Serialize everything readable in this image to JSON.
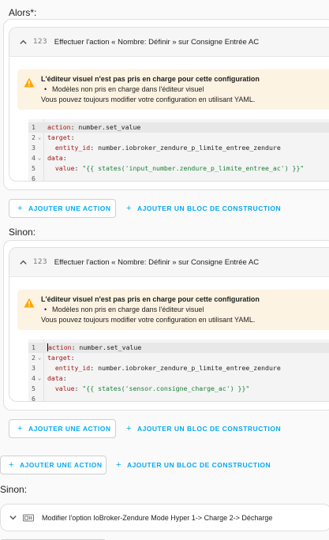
{
  "labels": {
    "alors": "Alors*:",
    "sinon1": "Sinon:",
    "sinon2": "Sinon:"
  },
  "actions": [
    {
      "icon_text": "123",
      "title": "Effectuer l'action « Nombre: Définir » sur Consigne Entrée AC",
      "warning": {
        "title": "L'éditeur visuel n'est pas pris en charge pour cette configuration",
        "bullet": "Modèles non pris en charge dans l'éditeur visuel",
        "text": "Vous pouvez toujours modifier votre configuration en utilisant YAML."
      },
      "code": {
        "line_numbers": [
          "1",
          "2",
          "3",
          "4",
          "5",
          "6"
        ],
        "k1": "action",
        "v1": ": number.set_value",
        "k2": "target",
        "v2": ":",
        "k3": "entity_id",
        "v3": ": number.iobroker_zendure_p_limite_entree_zendure",
        "k4": "data",
        "v4": ":",
        "k5": "value",
        "v5a": ": ",
        "v5b": "\"{{ states('input_number.zendure_p_limite_entree_ac') }}\""
      }
    },
    {
      "icon_text": "123",
      "title": "Effectuer l'action « Nombre: Définir » sur Consigne Entrée AC",
      "warning": {
        "title": "L'éditeur visuel n'est pas pris en charge pour cette configuration",
        "bullet": "Modèles non pris en charge dans l'éditeur visuel",
        "text": "Vous pouvez toujours modifier votre configuration en utilisant YAML."
      },
      "code": {
        "line_numbers": [
          "1",
          "2",
          "3",
          "4",
          "5",
          "6"
        ],
        "k1": "action",
        "v1": ": number.set_value",
        "k2": "target",
        "v2": ":",
        "k3": "entity_id",
        "v3": ": number.iobroker_zendure_p_limite_entree_zendure",
        "k4": "data",
        "v4": ":",
        "k5": "value",
        "v5a": ": ",
        "v5b": "\"{{ states('sensor.consigne_charge_ac') }}\""
      }
    }
  ],
  "buttons": {
    "add_action": "AJOUTER UNE ACTION",
    "add_block": "AJOUTER UN BLOC DE CONSTRUCTION",
    "plus": "+"
  },
  "bottom": {
    "title": "Modifier l'option IoBroker-Zendure Mode Hyper 1-> Charge 2-> Décharge"
  },
  "colors": {
    "accent": "#03a9f4",
    "warning_bg": "#fdf3e2",
    "warning_icon": "#ffa600",
    "yaml_key": "#a31515",
    "yaml_string": "#1a7f37"
  }
}
